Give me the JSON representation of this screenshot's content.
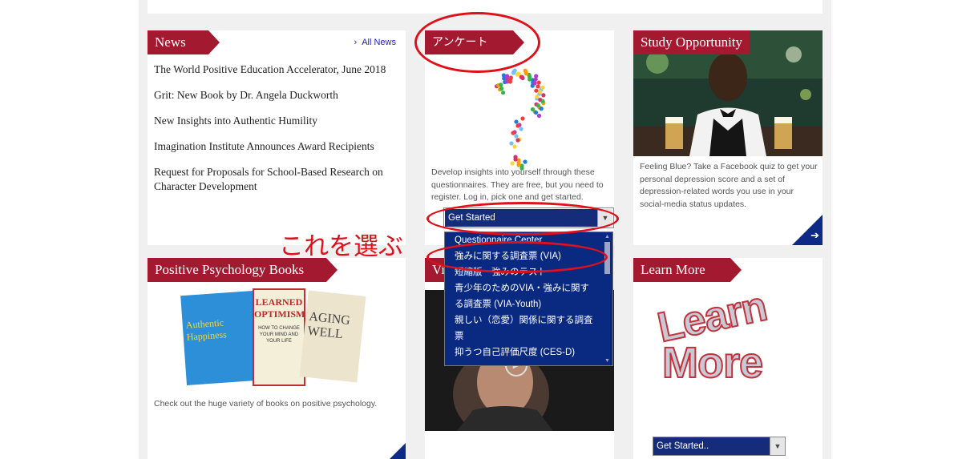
{
  "news": {
    "title": "News",
    "all_news_link": "All News",
    "items": [
      "The World Positive Education Accelerator, June 2018",
      "Grit: New Book by Dr. Angela Duckworth",
      "New Insights into Authentic Humility",
      "Imagination Institute Announces Award Recipients",
      "Request for Proposals for School-Based Research on Character Development"
    ]
  },
  "survey": {
    "title": "アンケート",
    "description": "Develop insights into yourself through these questionnaires. They are free, but you need to register. Log in, pick one and get started.",
    "select_value": "Get Started",
    "options": [
      "Questionnaire Center",
      "強みに関する調査票 (VIA)",
      "短縮版　強みのテスト",
      "青少年のためのVIA・強みに関する調査票 (VIA-Youth)",
      "親しい（恋愛）関係に関する調査票",
      "抑うつ自己評価尺度 (CES-D)"
    ]
  },
  "study": {
    "title": "Study Opportunity",
    "description": "Feeling Blue? Take a Facebook quiz to get your personal depression score and a set of depression-related words you use in your social-media status updates."
  },
  "books": {
    "title": "Positive Psychology Books",
    "cover_texts": [
      "Authentic Happiness",
      "LEARNED OPTIMISM",
      "HOW TO CHANGE YOUR MIND AND YOUR LIFE",
      "AGING WELL"
    ],
    "description": "Check out the huge variety of books on positive psychology."
  },
  "video": {
    "title_partial": "Vi"
  },
  "learn_more": {
    "title": "Learn More",
    "art_words": [
      "Learn",
      "More"
    ],
    "select_value": "Get Started.."
  },
  "annotation": {
    "text": "これを選ぶ"
  },
  "colors": {
    "ribbon": "#a3192f",
    "navy": "#0d2a87",
    "annotation": "#e0101a"
  }
}
